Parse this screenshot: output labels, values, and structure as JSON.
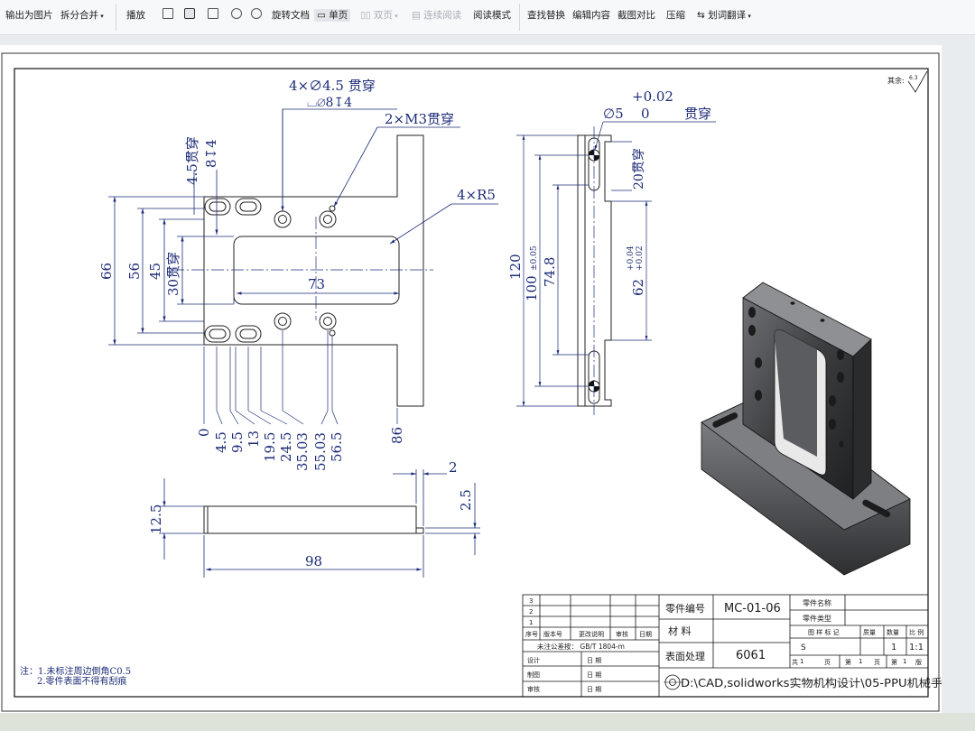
{
  "toolbar": {
    "export_image": "输出为图片",
    "split_merge": "拆分合并",
    "play": "播放",
    "rotate_doc": "旋转文档",
    "single_page": "单页",
    "double_page": "双页",
    "continuous_read": "连续阅读",
    "read_mode": "阅读模式",
    "find_replace": "查找替换",
    "edit_content": "编辑内容",
    "screenshot_compare": "截图对比",
    "compress": "压缩",
    "word_translate": "划词翻译"
  },
  "drawing": {
    "front_view": {
      "hole_callout": "4×∅4.5 贯穿",
      "counterbore": "⌴∅8↧4",
      "thread_callout": "2×M3贯穿",
      "radius_callout": "4×R5",
      "slot_depth_1": "4.5贯穿",
      "slot_depth_2": "8↧4",
      "height_66": "66",
      "height_56": "56",
      "height_45": "45",
      "height_30": "30贯穿",
      "width_73": "73",
      "ord_values": [
        "0",
        "4.5",
        "9.5",
        "13",
        "19.5",
        "24.5",
        "35.03",
        "55.03",
        "56.5"
      ],
      "ord_86": "86"
    },
    "side_view": {
      "hole_upper_tol": "+0.02",
      "hole_dia": "∅5",
      "hole_lower_tol": "0",
      "hole_through": "贯穿",
      "dim_120": "120",
      "dim_100": "100",
      "dim_100_tol": "±0.05",
      "dim_74_8": "74.8",
      "dim_62": "62",
      "dim_62_tol_up": "+0.04",
      "dim_62_tol_low": "+0.02",
      "dim_20": "20贯穿"
    },
    "bottom_view": {
      "dim_12_5": "12.5",
      "dim_98": "98",
      "dim_2": "2",
      "dim_2_5": "2.5"
    },
    "roughness": "其余:",
    "roughness_value": "6.3",
    "notes": [
      "注：1.未标注周边倒角C0.5",
      "2.零件表面不得有刮痕"
    ]
  },
  "title_block": {
    "rev_rows": [
      "3",
      "2",
      "1"
    ],
    "rev_headers": [
      "序号",
      "版本号",
      "更改说明",
      "审核",
      "日期"
    ],
    "tolerance": "未注公差按：  GB/T 1804-m",
    "sign_labels": [
      "设计",
      "制图",
      "审核"
    ],
    "date_label": "日  期",
    "part_no_label": "零件编号",
    "part_no": "MC-01-06",
    "material_label": "材  料",
    "surface_label": "表面处理",
    "surface_value": "6061",
    "part_name_label": "零件名称",
    "part_type_label": "零件类型",
    "stage_label": "图 样 标 记",
    "weight_label": "质量",
    "qty_label": "数量",
    "scale_label": "比 例",
    "stage_value": "S",
    "qty_value": "1",
    "scale_value": "1:1",
    "total_label": "共",
    "total_value": "1",
    "page_unit": "页",
    "page_label": "第",
    "page_value": "1",
    "sheet_label": "第",
    "sheet_value": "1",
    "version_label": "版",
    "file_path": "D:\\CAD,solidworks实物机构设计\\05-PPU机械手"
  }
}
